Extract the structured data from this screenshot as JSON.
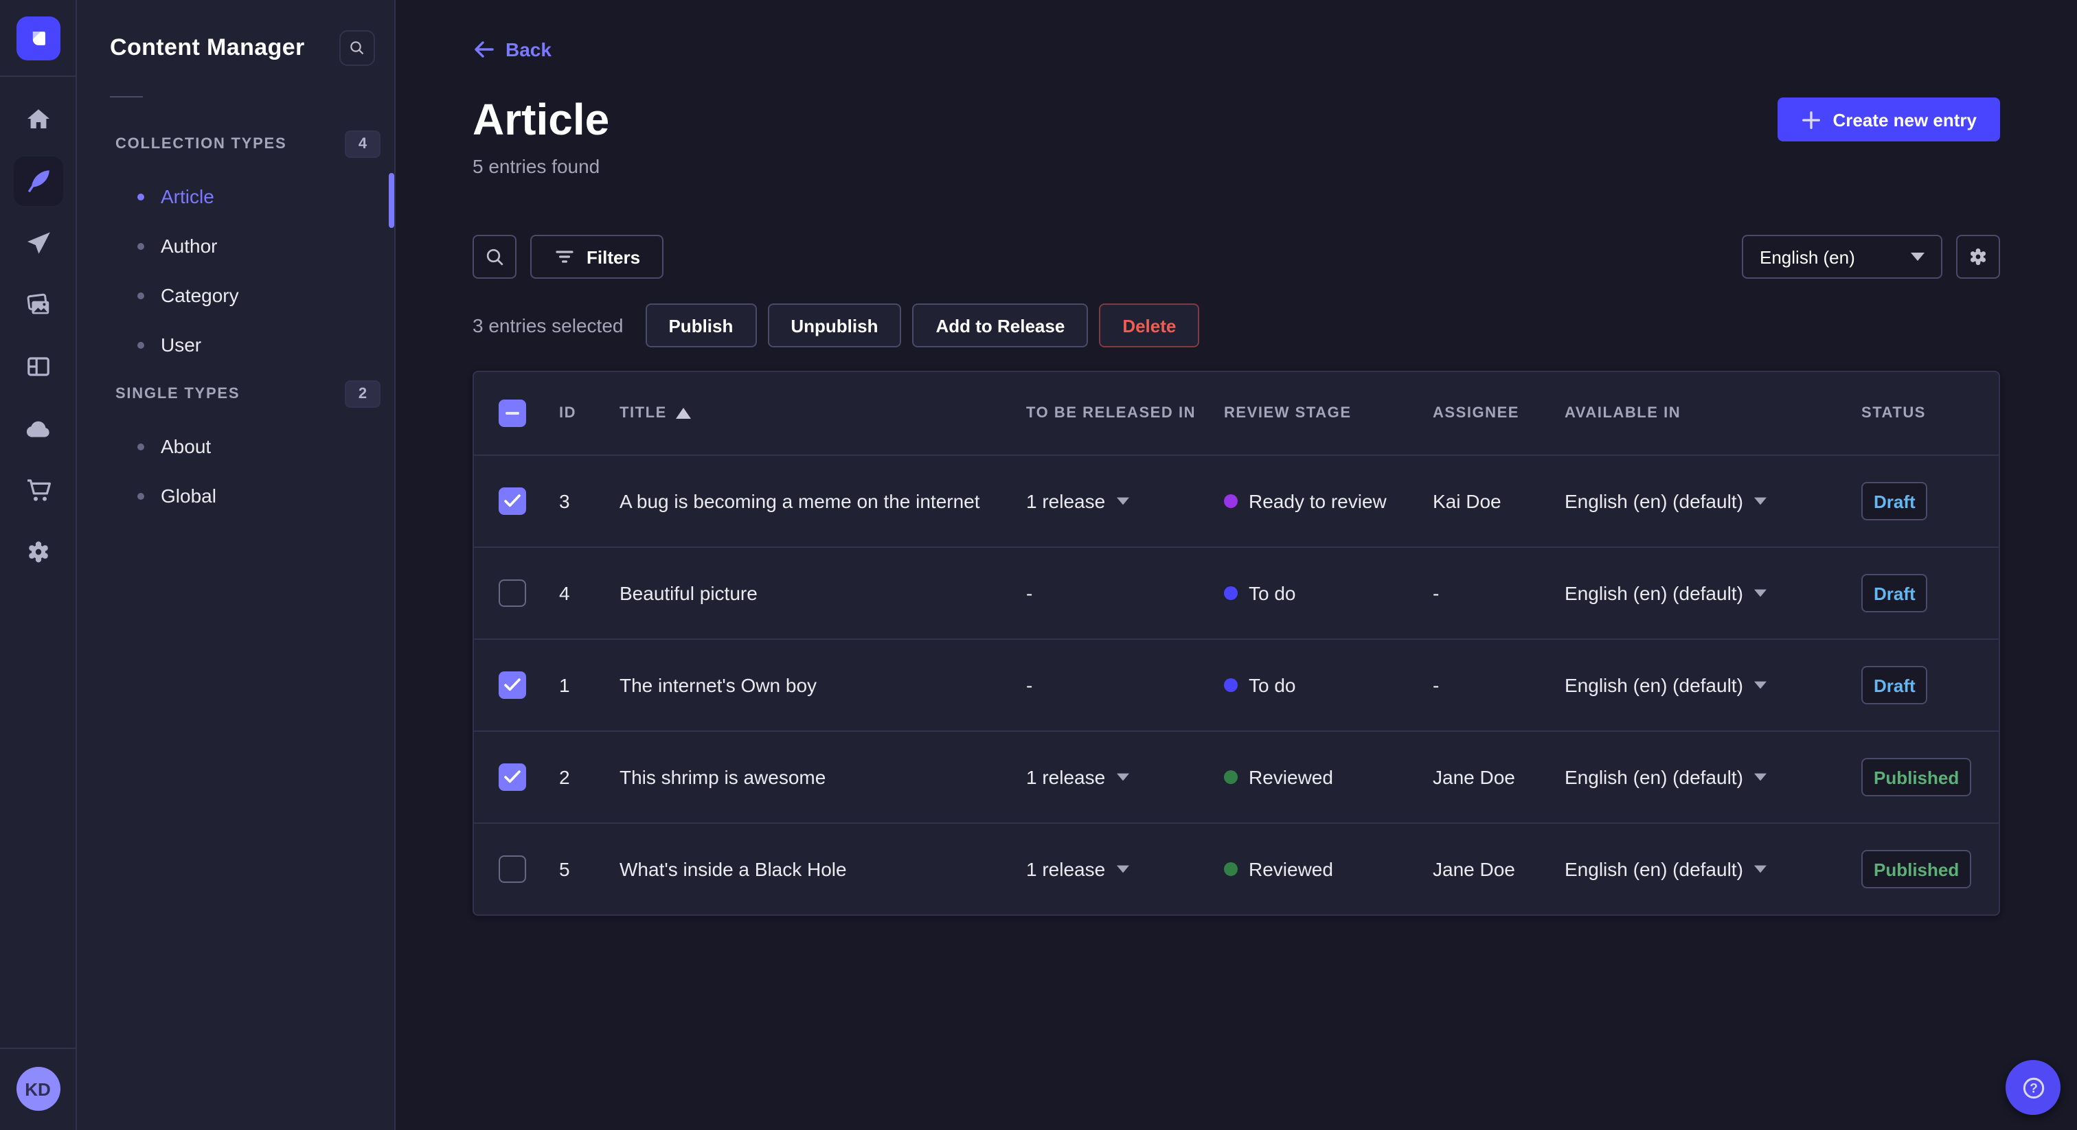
{
  "colors": {
    "primary": "#4945ff",
    "primary_light": "#7b79ff",
    "page_background": "#181826",
    "panel_background": "#212134",
    "border": "#32324d",
    "draft_text": "#66b7f1",
    "published_text": "#5cb176",
    "danger": "#ee5e52",
    "stage_todo": "#4945ff",
    "stage_ready_to_review": "#9736e8",
    "stage_reviewed": "#328048"
  },
  "nav_rail": {
    "icons": [
      "strapi-logo",
      "home",
      "content-manager",
      "releases",
      "media-library",
      "content-type-builder",
      "cloud",
      "marketplace",
      "settings"
    ],
    "active_icon": "content-manager",
    "avatar_initials": "KD"
  },
  "sidebar": {
    "title": "Content Manager",
    "sections": [
      {
        "label": "COLLECTION TYPES",
        "count": "4",
        "items": [
          {
            "label": "Article",
            "active": true
          },
          {
            "label": "Author",
            "active": false
          },
          {
            "label": "Category",
            "active": false
          },
          {
            "label": "User",
            "active": false
          }
        ]
      },
      {
        "label": "SINGLE TYPES",
        "count": "2",
        "items": [
          {
            "label": "About",
            "active": false
          },
          {
            "label": "Global",
            "active": false
          }
        ]
      }
    ]
  },
  "header": {
    "back_label": "Back",
    "title": "Article",
    "subtitle": "5 entries found",
    "create_button_label": "Create new entry"
  },
  "toolbar": {
    "filters_button_label": "Filters",
    "locale_select_value": "English (en)"
  },
  "selection": {
    "summary": "3 entries selected",
    "publish_label": "Publish",
    "unpublish_label": "Unpublish",
    "add_to_release_label": "Add to Release",
    "delete_label": "Delete"
  },
  "table": {
    "columns": [
      "ID",
      "TITLE",
      "TO BE RELEASED IN",
      "REVIEW STAGE",
      "ASSIGNEE",
      "AVAILABLE IN",
      "STATUS"
    ],
    "sorted_column": "TITLE",
    "sort_direction": "asc",
    "rows": [
      {
        "selected": true,
        "id": "3",
        "title": "A bug is becoming a meme on the internet",
        "to_be_released_in": "1 release",
        "review_stage": "Ready to review",
        "review_stage_color": "#9736e8",
        "assignee": "Kai Doe",
        "available_in": "English (en) (default)",
        "status": "Draft"
      },
      {
        "selected": false,
        "id": "4",
        "title": "Beautiful picture",
        "to_be_released_in": "-",
        "review_stage": "To do",
        "review_stage_color": "#4945ff",
        "assignee": "-",
        "available_in": "English (en) (default)",
        "status": "Draft"
      },
      {
        "selected": true,
        "id": "1",
        "title": "The internet's Own boy",
        "to_be_released_in": "-",
        "review_stage": "To do",
        "review_stage_color": "#4945ff",
        "assignee": "-",
        "available_in": "English (en) (default)",
        "status": "Draft"
      },
      {
        "selected": true,
        "id": "2",
        "title": "This shrimp is awesome",
        "to_be_released_in": "1 release",
        "review_stage": "Reviewed",
        "review_stage_color": "#328048",
        "assignee": "Jane Doe",
        "available_in": "English (en) (default)",
        "status": "Published"
      },
      {
        "selected": false,
        "id": "5",
        "title": "What's inside a Black Hole",
        "to_be_released_in": "1 release",
        "review_stage": "Reviewed",
        "review_stage_color": "#328048",
        "assignee": "Jane Doe",
        "available_in": "English (en) (default)",
        "status": "Published"
      }
    ]
  },
  "help": {
    "icon": "question-mark-circle"
  }
}
